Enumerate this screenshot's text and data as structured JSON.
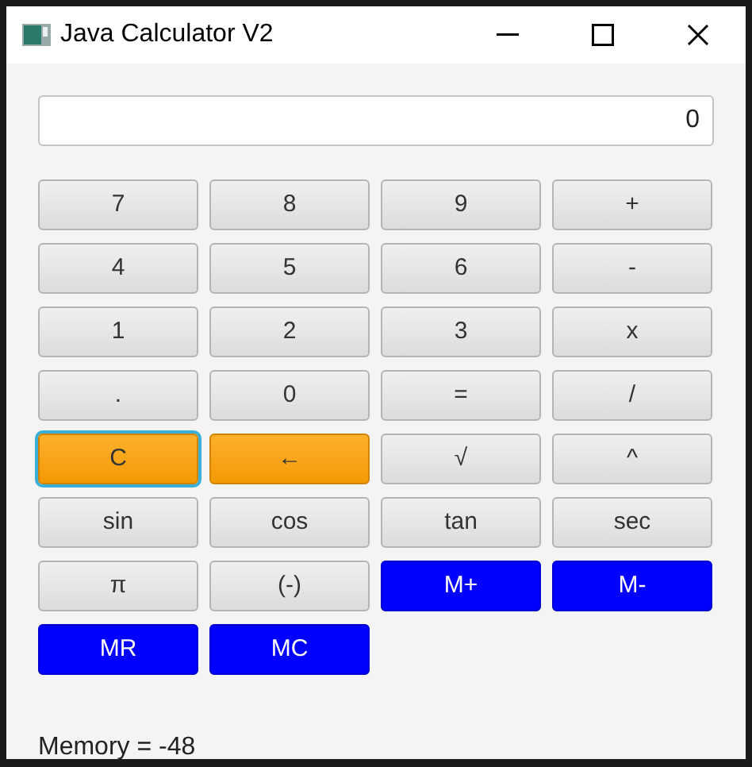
{
  "window": {
    "title": "Java Calculator V2"
  },
  "display": {
    "value": "0"
  },
  "buttons": [
    {
      "label": "7",
      "kind": "plain",
      "focused": false
    },
    {
      "label": "8",
      "kind": "plain",
      "focused": false
    },
    {
      "label": "9",
      "kind": "plain",
      "focused": false
    },
    {
      "label": "+",
      "kind": "plain",
      "focused": false
    },
    {
      "label": "4",
      "kind": "plain",
      "focused": false
    },
    {
      "label": "5",
      "kind": "plain",
      "focused": false
    },
    {
      "label": "6",
      "kind": "plain",
      "focused": false
    },
    {
      "label": "-",
      "kind": "plain",
      "focused": false
    },
    {
      "label": "1",
      "kind": "plain",
      "focused": false
    },
    {
      "label": "2",
      "kind": "plain",
      "focused": false
    },
    {
      "label": "3",
      "kind": "plain",
      "focused": false
    },
    {
      "label": "x",
      "kind": "plain",
      "focused": false
    },
    {
      "label": ".",
      "kind": "plain",
      "focused": false
    },
    {
      "label": "0",
      "kind": "plain",
      "focused": false
    },
    {
      "label": "=",
      "kind": "plain",
      "focused": false
    },
    {
      "label": "/",
      "kind": "plain",
      "focused": false
    },
    {
      "label": "C",
      "kind": "orange",
      "focused": true
    },
    {
      "label": "←",
      "kind": "orange",
      "focused": false
    },
    {
      "label": "√",
      "kind": "plain",
      "focused": false
    },
    {
      "label": "^",
      "kind": "plain",
      "focused": false
    },
    {
      "label": "sin",
      "kind": "plain",
      "focused": false
    },
    {
      "label": "cos",
      "kind": "plain",
      "focused": false
    },
    {
      "label": "tan",
      "kind": "plain",
      "focused": false
    },
    {
      "label": "sec",
      "kind": "plain",
      "focused": false
    },
    {
      "label": "π",
      "kind": "plain",
      "focused": false
    },
    {
      "label": "(-)",
      "kind": "plain",
      "focused": false
    },
    {
      "label": "M+",
      "kind": "blue",
      "focused": false
    },
    {
      "label": "M-",
      "kind": "blue",
      "focused": false
    },
    {
      "label": "MR",
      "kind": "blue",
      "focused": false
    },
    {
      "label": "MC",
      "kind": "blue",
      "focused": false
    }
  ],
  "memory": {
    "text": "Memory = -48"
  }
}
